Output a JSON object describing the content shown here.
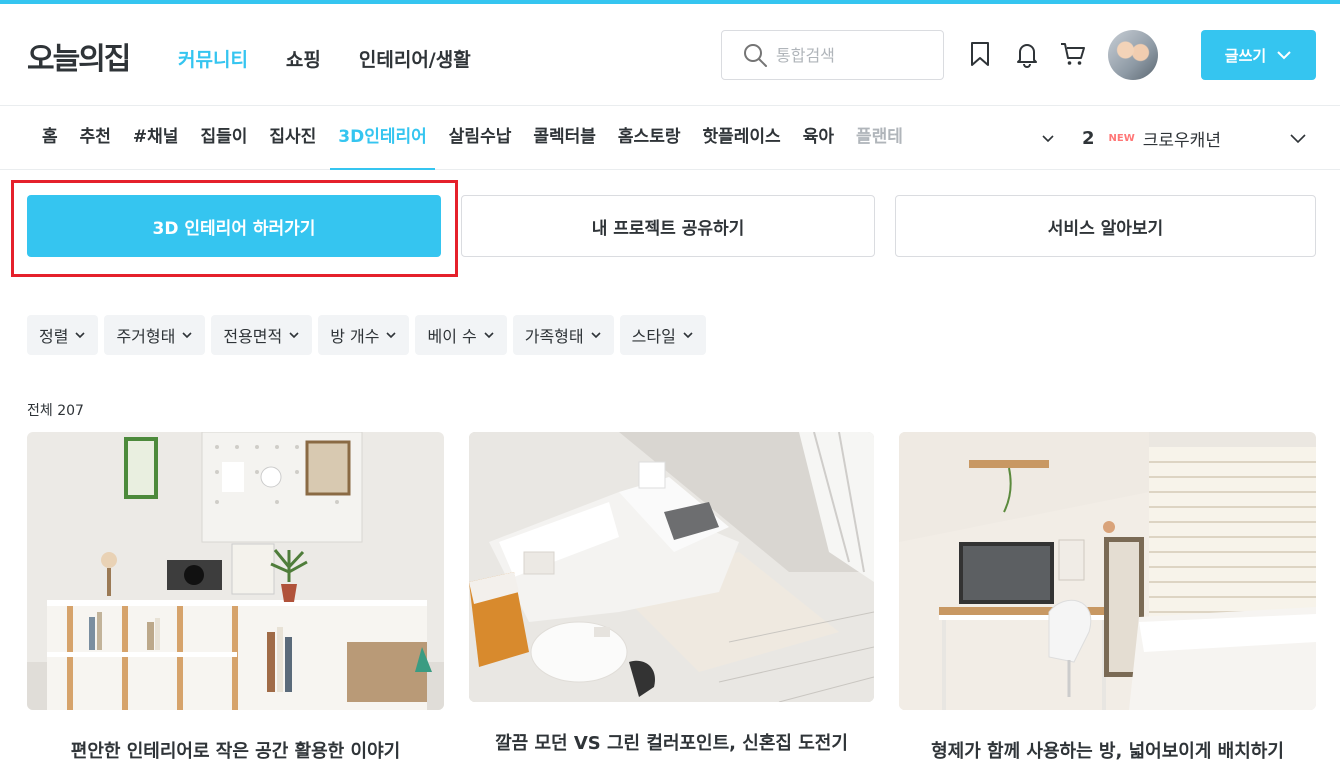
{
  "header": {
    "logo": "오늘의집",
    "nav": [
      "커뮤니티",
      "쇼핑",
      "인테리어/생활"
    ],
    "search_placeholder": "통합검색",
    "write_label": "글쓰기"
  },
  "subnav": {
    "items": [
      "홈",
      "추천",
      "#채널",
      "집들이",
      "집사진",
      "3D인테리어",
      "살림수납",
      "콜렉터블",
      "홈스토랑",
      "핫플레이스",
      "육아",
      "플랜테"
    ],
    "active_index": 5,
    "rank": {
      "number": "2",
      "badge": "NEW",
      "keyword": "크로우캐년"
    }
  },
  "actions": {
    "primary": "3D 인테리어 하러가기",
    "share": "내 프로젝트 공유하기",
    "about": "서비스 알아보기"
  },
  "filters": [
    "정렬",
    "주거형태",
    "전용면적",
    "방 개수",
    "베이 수",
    "가족형태",
    "스타일"
  ],
  "total_label": "전체 207",
  "cards": [
    {
      "title": "편안한 인테리어로 작은 공간 활용한 이야기"
    },
    {
      "title": "깔끔 모던 VS 그린 컬러포인트, 신혼집 도전기"
    },
    {
      "title": "형제가 함께 사용하는 방, 넓어보이게 배치하기"
    }
  ],
  "colors": {
    "accent": "#35c5f0",
    "highlight": "#e5202b",
    "text": "#2f3438"
  }
}
